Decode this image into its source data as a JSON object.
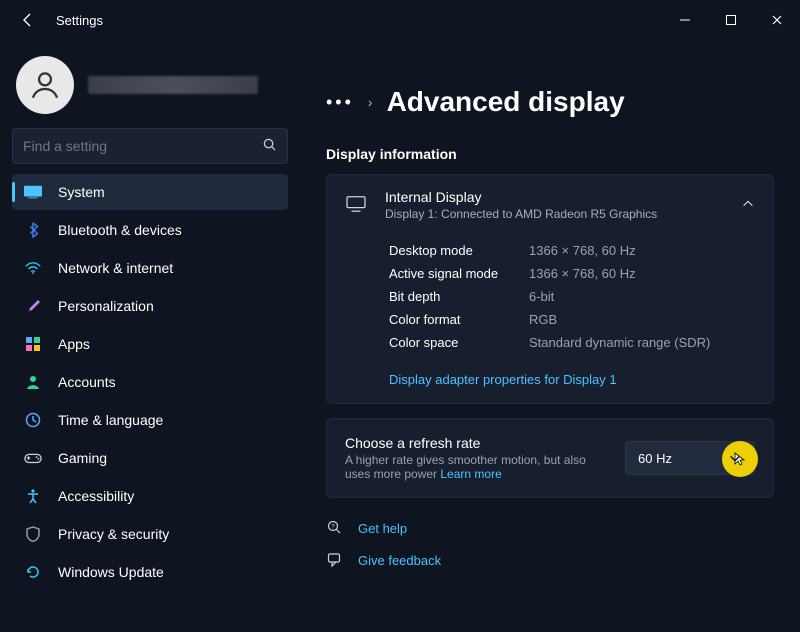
{
  "window": {
    "title": "Settings"
  },
  "profile": {
    "name_redacted": true
  },
  "search": {
    "placeholder": "Find a setting"
  },
  "nav": [
    {
      "label": "System",
      "icon": "system",
      "selected": true
    },
    {
      "label": "Bluetooth & devices",
      "icon": "bluetooth"
    },
    {
      "label": "Network & internet",
      "icon": "wifi"
    },
    {
      "label": "Personalization",
      "icon": "brush"
    },
    {
      "label": "Apps",
      "icon": "apps"
    },
    {
      "label": "Accounts",
      "icon": "user"
    },
    {
      "label": "Time & language",
      "icon": "clock"
    },
    {
      "label": "Gaming",
      "icon": "gaming"
    },
    {
      "label": "Accessibility",
      "icon": "accessibility"
    },
    {
      "label": "Privacy & security",
      "icon": "shield"
    },
    {
      "label": "Windows Update",
      "icon": "update"
    }
  ],
  "breadcrumb": {
    "title": "Advanced display"
  },
  "display_info": {
    "section_title": "Display information",
    "card_title": "Internal Display",
    "card_sub": "Display 1: Connected to AMD Radeon R5 Graphics",
    "props": [
      {
        "label": "Desktop mode",
        "value": "1366 × 768, 60 Hz"
      },
      {
        "label": "Active signal mode",
        "value": "1366 × 768, 60 Hz"
      },
      {
        "label": "Bit depth",
        "value": "6-bit"
      },
      {
        "label": "Color format",
        "value": "RGB"
      },
      {
        "label": "Color space",
        "value": "Standard dynamic range (SDR)"
      }
    ],
    "adapter_link": "Display adapter properties for Display 1"
  },
  "refresh": {
    "title": "Choose a refresh rate",
    "sub_prefix": "A higher rate gives smoother motion, but also uses more power  ",
    "learn_more": "Learn more",
    "selected": "60 Hz"
  },
  "footer": {
    "help": "Get help",
    "feedback": "Give feedback"
  }
}
